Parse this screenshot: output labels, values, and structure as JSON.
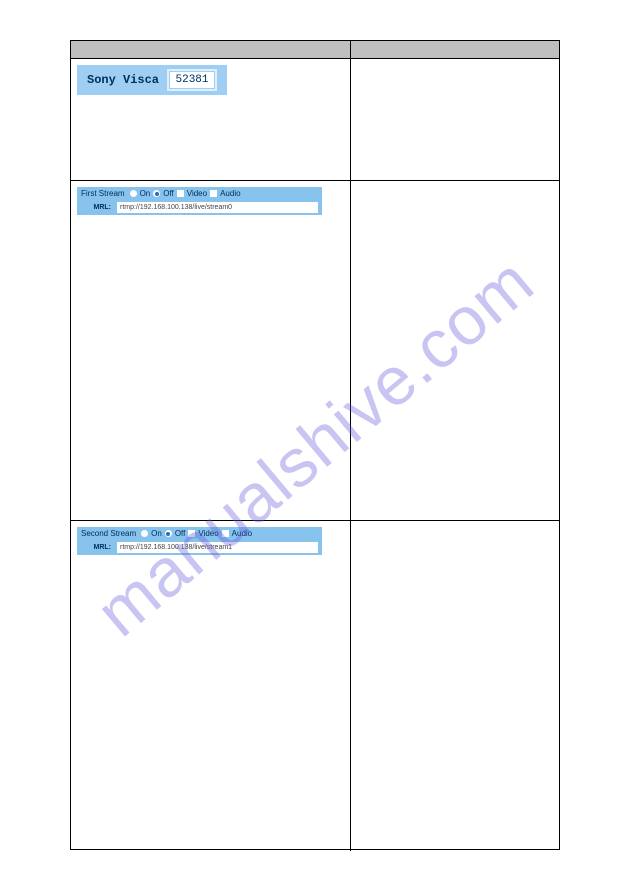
{
  "watermark": "manualshive.com",
  "visca": {
    "label": "Sony Visca",
    "port": "52381"
  },
  "first_stream": {
    "title": "First Stream",
    "on_label": "On",
    "off_label": "Off",
    "video_label": "Video",
    "audio_label": "Audio",
    "mrl_label": "MRL:",
    "mrl_value": "rtmp://192.168.100.138/live/stream0"
  },
  "second_stream": {
    "title": "Second Stream",
    "on_label": "On",
    "off_label": "Off",
    "video_label": "Video",
    "audio_label": "Audio",
    "mrl_label": "MRL:",
    "mrl_value": "rtmp://192.168.100.138/live/stream1"
  }
}
